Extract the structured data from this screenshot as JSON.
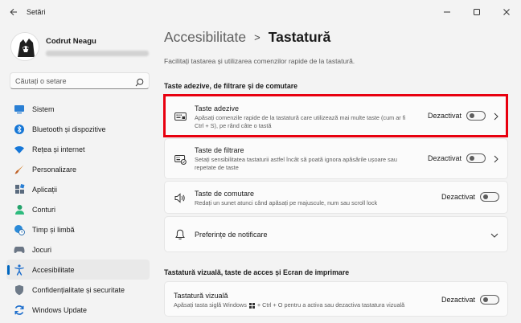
{
  "window": {
    "title": "Setări"
  },
  "profile": {
    "name": "Codrut Neagu"
  },
  "search": {
    "placeholder": "Căutați o setare"
  },
  "sidebar": {
    "items": [
      {
        "label": "Sistem",
        "icon": "monitor-icon"
      },
      {
        "label": "Bluetooth și dispozitive",
        "icon": "bluetooth-icon"
      },
      {
        "label": "Rețea și internet",
        "icon": "wifi-icon"
      },
      {
        "label": "Personalizare",
        "icon": "brush-icon"
      },
      {
        "label": "Aplicații",
        "icon": "apps-icon"
      },
      {
        "label": "Conturi",
        "icon": "person-icon"
      },
      {
        "label": "Timp și limbă",
        "icon": "globe-clock-icon"
      },
      {
        "label": "Jocuri",
        "icon": "gamepad-icon"
      },
      {
        "label": "Accesibilitate",
        "icon": "accessibility-icon",
        "active": true
      },
      {
        "label": "Confidențialitate și securitate",
        "icon": "shield-icon"
      },
      {
        "label": "Windows Update",
        "icon": "update-icon"
      }
    ]
  },
  "breadcrumb": {
    "parent": "Accesibilitate",
    "separator": ">",
    "current": "Tastatură"
  },
  "page": {
    "description": "Facilitați tastarea și utilizarea comenzilor rapide de la tastatură."
  },
  "sections": {
    "sticky": {
      "title": "Taste adezive, de filtrare și de comutare"
    },
    "visual": {
      "title": "Tastatură vizuală, taste de acces și Ecran de imprimare"
    }
  },
  "cards": {
    "sticky_keys": {
      "title": "Taste adezive",
      "desc1": "Apăsați comenzile rapide de la tastatură care utilizează mai multe taste (cum ar fi",
      "desc2": "Ctrl + S), pe rând câte o tastă",
      "status": "Dezactivat"
    },
    "filter_keys": {
      "title": "Taste de filtrare",
      "desc1": "Setați sensibilitatea tastaturii astfel încât să poată ignora apăsările ușoare sau",
      "desc2": "repetate de taste",
      "status": "Dezactivat"
    },
    "toggle_keys": {
      "title": "Taste de comutare",
      "desc1": "Redați un sunet atunci când apăsați pe majuscule, num sau scroll lock",
      "status": "Dezactivat"
    },
    "notifications": {
      "title": "Preferințe de notificare"
    },
    "onscreen_keyboard": {
      "title": "Tastatură vizuală",
      "desc_before": "Apăsați tasta siglă Windows",
      "desc_after": "+ Ctrl + O pentru a activa sau dezactiva tastatura vizuală",
      "status": "Dezactivat"
    }
  },
  "colors": {
    "accent": "#0067c0",
    "highlight": "#e8000f",
    "background": "#f3f3f3",
    "card": "#fbfbfb"
  }
}
